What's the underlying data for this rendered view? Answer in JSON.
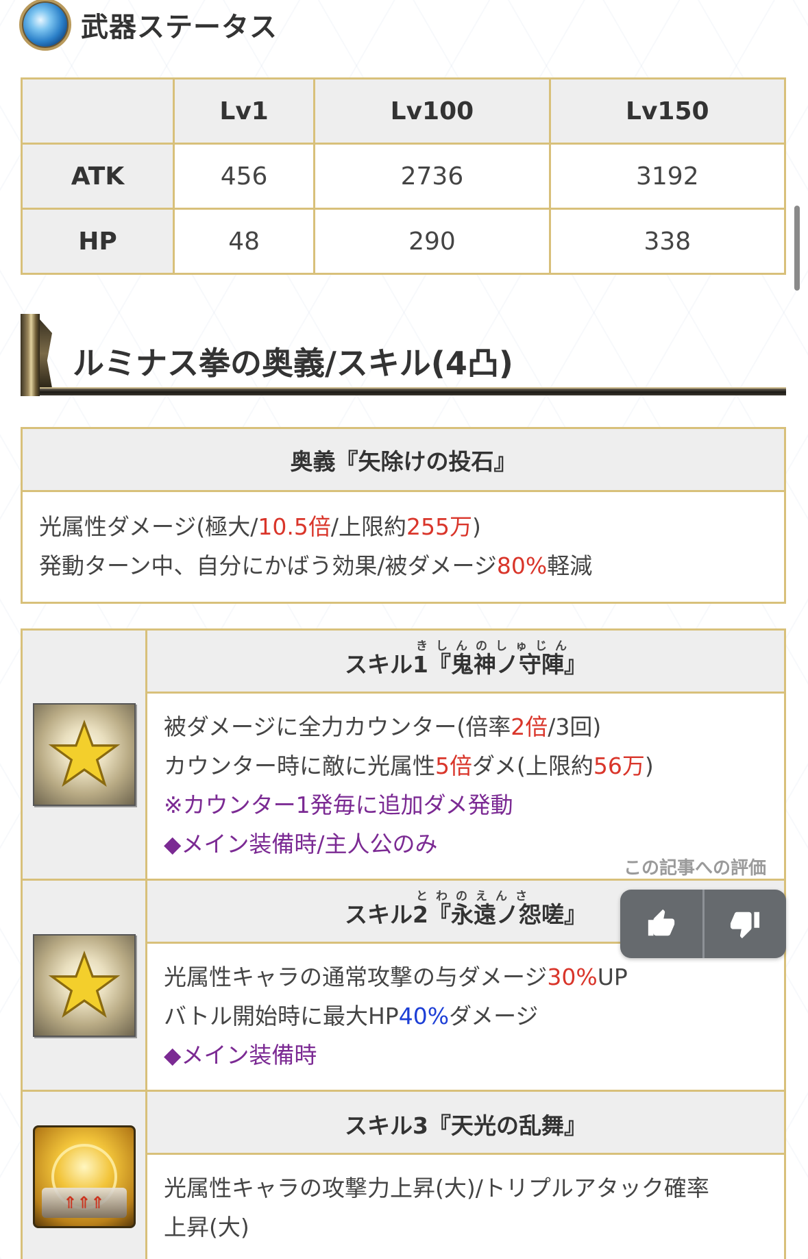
{
  "weapon_status": {
    "title": "武器ステータス",
    "table": {
      "columns": [
        "",
        "Lv1",
        "Lv100",
        "Lv150"
      ],
      "rows": [
        {
          "label": "ATK",
          "values": [
            "456",
            "2736",
            "3192"
          ]
        },
        {
          "label": "HP",
          "values": [
            "48",
            "290",
            "338"
          ]
        }
      ]
    }
  },
  "skills_section": {
    "title": "ルミナス拳の奥義/スキル(4凸)"
  },
  "ougi": {
    "title": "奥義『矢除けの投石』",
    "line1": {
      "a": "光属性ダメージ(極大/",
      "b": "10.5倍",
      "c": "/上限約",
      "d": "255万",
      "e": ")"
    },
    "line2": {
      "a": "発動ターン中、自分にかばう効果/被ダメージ",
      "b": "80%",
      "c": "軽減"
    }
  },
  "skills": [
    {
      "icon": "star-icon",
      "prefix": "スキル1『",
      "name": "鬼神ノ守陣",
      "suffix": "』",
      "ruby": "きしんのしゅじん",
      "line1": {
        "a": "被ダメージに全力カウンター(倍率",
        "b": "2倍",
        "c": "/3回)"
      },
      "line2": {
        "a": "カウンター時に敵に光属性",
        "b": "5倍",
        "c": "ダメ(上限約",
        "d": "56万",
        "e": ")"
      },
      "line3": "※カウンター1発毎に追加ダメ発動",
      "line4": "◆メイン装備時/主人公のみ"
    },
    {
      "icon": "star-icon",
      "prefix": "スキル2『",
      "name": "永遠ノ怨嗟",
      "suffix": "』",
      "ruby": "とわのえんさ",
      "line1": {
        "a": "光属性キャラの通常攻撃の与ダメージ",
        "b": "30%",
        "c": "UP"
      },
      "line2": {
        "a": "バトル開始時に最大HP",
        "b": "40%",
        "c": "ダメージ"
      },
      "line3": "◆メイン装備時"
    },
    {
      "icon": "triple-attack-icon",
      "title": "スキル3『天光の乱舞』",
      "line1": "光属性キャラの攻撃力上昇(大)/トリプルアタック確率",
      "line2": "上昇(大)"
    }
  ],
  "rating": {
    "label": "この記事への評価",
    "like_icon": "thumbs-up-icon",
    "dislike_icon": "thumbs-down-icon"
  }
}
